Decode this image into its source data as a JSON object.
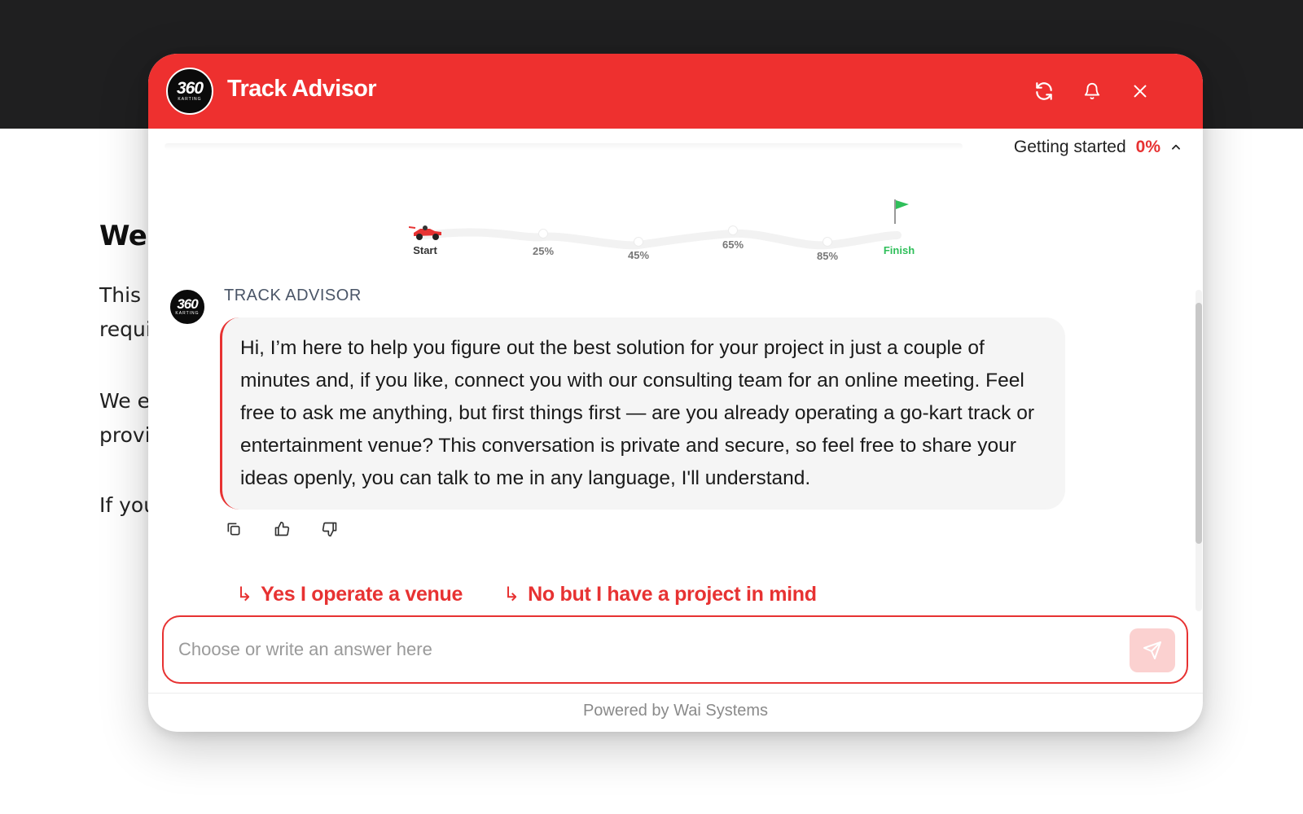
{
  "background_page": {
    "title": "Wel",
    "paragraphs": [
      "This\nrequi",
      "We e\nprovi",
      "If you"
    ]
  },
  "widget": {
    "logo": {
      "text": "360",
      "subtext": "KARTING"
    },
    "title": "Track Advisor",
    "header_icons": [
      "refresh-icon",
      "bell-icon",
      "close-icon"
    ],
    "progress": {
      "label": "Getting started",
      "percent": "0%"
    },
    "track": {
      "checkpoints": [
        {
          "label": "Start"
        },
        {
          "label": "25%"
        },
        {
          "label": "45%"
        },
        {
          "label": "65%"
        },
        {
          "label": "85%"
        },
        {
          "label": "Finish"
        }
      ]
    },
    "message": {
      "sender": "TRACK ADVISOR",
      "text": "Hi, I’m here to help you figure out the best solution for your project in just a couple of minutes and, if you like, connect you with our consulting team for an online meeting. Feel free to ask me anything, but first things first — are you already operating a go-kart track or entertainment venue? This conversation is private and secure, so feel free to share your ideas openly, you can talk to me in any language, I'll understand."
    },
    "message_actions": [
      "copy-icon",
      "thumbs-up-icon",
      "thumbs-down-icon"
    ],
    "suggestions": [
      "Yes I operate a venue",
      "No but I have a project in mind"
    ],
    "input": {
      "placeholder": "Choose or write an answer here",
      "value": ""
    },
    "footer": "Powered by Wai Systems",
    "colors": {
      "accent": "#ee302f",
      "finish": "#2fbf5a",
      "send_bg": "#fbd1d0"
    }
  }
}
